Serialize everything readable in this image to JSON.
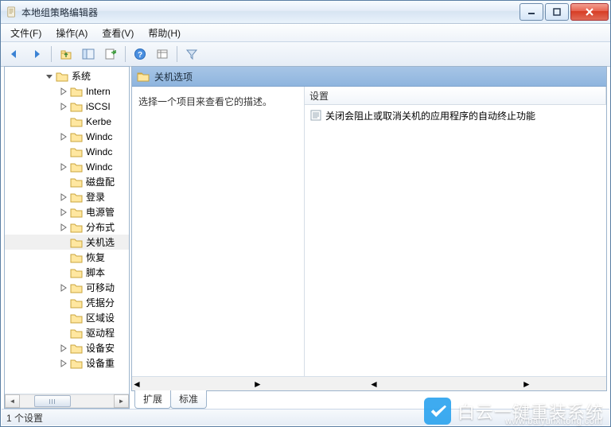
{
  "window": {
    "title": "本地组策略编辑器"
  },
  "menu": {
    "file": "文件(F)",
    "action": "操作(A)",
    "view": "查看(V)",
    "help": "帮助(H)"
  },
  "toolbar": {
    "back": "后退",
    "forward": "前进",
    "up": "上一级",
    "show_hide_tree": "显示/隐藏控制台树",
    "properties": "属性",
    "export": "导出列表",
    "help": "帮助",
    "view_options": "查看选项",
    "filter": "筛选"
  },
  "tree": {
    "root": "系统",
    "items": [
      {
        "label": "Intern",
        "expandable": true
      },
      {
        "label": "iSCSI",
        "expandable": true
      },
      {
        "label": "Kerbe",
        "expandable": false
      },
      {
        "label": "Windc",
        "expandable": true
      },
      {
        "label": "Windc",
        "expandable": false
      },
      {
        "label": "Windc",
        "expandable": true
      },
      {
        "label": "磁盘配",
        "expandable": false
      },
      {
        "label": "登录",
        "expandable": true
      },
      {
        "label": "电源管",
        "expandable": true
      },
      {
        "label": "分布式",
        "expandable": true
      },
      {
        "label": "关机选",
        "expandable": false,
        "selected": true
      },
      {
        "label": "恢复",
        "expandable": false
      },
      {
        "label": "脚本",
        "expandable": false
      },
      {
        "label": "可移动",
        "expandable": true
      },
      {
        "label": "凭据分",
        "expandable": false
      },
      {
        "label": "区域设",
        "expandable": false
      },
      {
        "label": "驱动程",
        "expandable": false
      },
      {
        "label": "设备安",
        "expandable": true
      },
      {
        "label": "设备重",
        "expandable": true
      }
    ]
  },
  "right": {
    "header": "关机选项",
    "description_prompt": "选择一个项目来查看它的描述。",
    "column_setting": "设置",
    "rows": [
      "关闭会阻止或取消关机的应用程序的自动终止功能"
    ],
    "tabs": {
      "extended": "扩展",
      "standard": "标准"
    }
  },
  "status": {
    "text": "1 个设置"
  },
  "watermark": {
    "text": "白云一键重装系统",
    "sub": "www.baiyunxitong.com"
  }
}
